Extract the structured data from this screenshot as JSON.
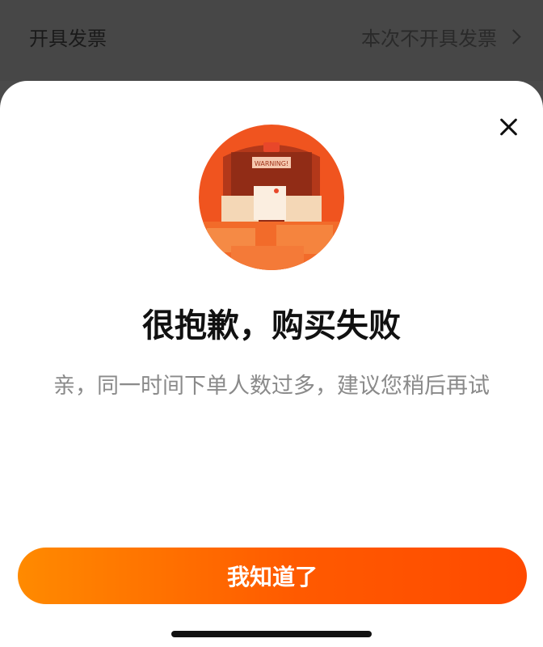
{
  "background": {
    "left_label": "开具发票",
    "right_label": "本次不开具发票"
  },
  "dialog": {
    "title": "很抱歉，购买失败",
    "message": "亲，同一时间下单人数过多，建议您稍后再试",
    "confirm_label": "我知道了",
    "close_icon": "close-icon",
    "illustration_sign_text": "WARNING!"
  },
  "colors": {
    "accent_start": "#ff8a00",
    "accent_end": "#ff4a00",
    "overlay": "#4a4a4a"
  }
}
